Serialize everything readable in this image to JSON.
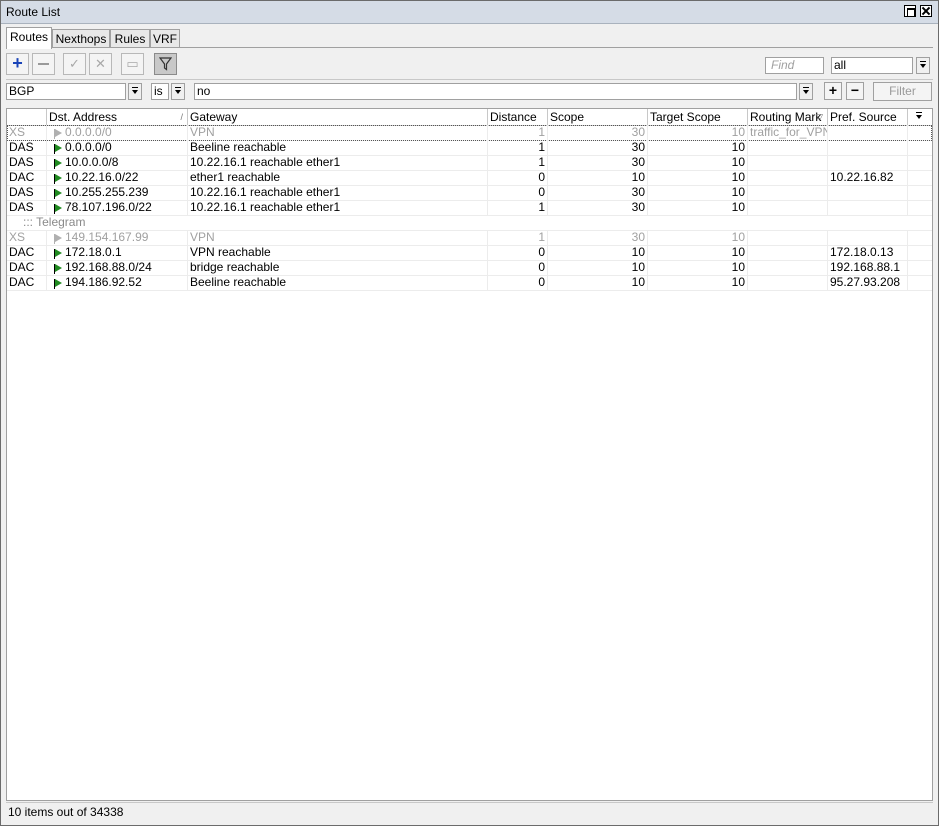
{
  "window": {
    "title": "Route List"
  },
  "tabs": [
    "Routes",
    "Nexthops",
    "Rules",
    "VRF"
  ],
  "toolbar": {
    "find_placeholder": "Find",
    "scope_select": "all"
  },
  "filter": {
    "field": "BGP",
    "operator": "is",
    "value": "no",
    "button_label": "Filter",
    "add_symbol": "+",
    "remove_symbol": "−"
  },
  "columns": [
    "",
    "Dst. Address",
    "Gateway",
    "Distance",
    "Scope",
    "Target Scope",
    "Routing Mark",
    "Pref. Source"
  ],
  "rows": [
    {
      "flags": "XS",
      "dst": "0.0.0.0/0",
      "gateway": "VPN",
      "distance": "1",
      "scope": "30",
      "target_scope": "10",
      "routing_mark": "traffic_for_VPN",
      "pref_source": ""
    },
    {
      "flags": "DAS",
      "dst": "0.0.0.0/0",
      "gateway": "Beeline reachable",
      "distance": "1",
      "scope": "30",
      "target_scope": "10",
      "routing_mark": "",
      "pref_source": ""
    },
    {
      "flags": "DAS",
      "dst": "10.0.0.0/8",
      "gateway": "10.22.16.1 reachable ether1",
      "distance": "1",
      "scope": "30",
      "target_scope": "10",
      "routing_mark": "",
      "pref_source": ""
    },
    {
      "flags": "DAC",
      "dst": "10.22.16.0/22",
      "gateway": "ether1 reachable",
      "distance": "0",
      "scope": "10",
      "target_scope": "10",
      "routing_mark": "",
      "pref_source": "10.22.16.82"
    },
    {
      "flags": "DAS",
      "dst": "10.255.255.239",
      "gateway": "10.22.16.1 reachable ether1",
      "distance": "0",
      "scope": "30",
      "target_scope": "10",
      "routing_mark": "",
      "pref_source": ""
    },
    {
      "flags": "DAS",
      "dst": "78.107.196.0/22",
      "gateway": "10.22.16.1 reachable ether1",
      "distance": "1",
      "scope": "30",
      "target_scope": "10",
      "routing_mark": "",
      "pref_source": ""
    },
    {
      "comment": "::: Telegram"
    },
    {
      "flags": "XS",
      "dst": "149.154.167.99",
      "gateway": "VPN",
      "distance": "1",
      "scope": "30",
      "target_scope": "10",
      "routing_mark": "",
      "pref_source": ""
    },
    {
      "flags": "DAC",
      "dst": "172.18.0.1",
      "gateway": "VPN reachable",
      "distance": "0",
      "scope": "10",
      "target_scope": "10",
      "routing_mark": "",
      "pref_source": "172.18.0.13"
    },
    {
      "flags": "DAC",
      "dst": "192.168.88.0/24",
      "gateway": "bridge reachable",
      "distance": "0",
      "scope": "10",
      "target_scope": "10",
      "routing_mark": "",
      "pref_source": "192.168.88.1"
    },
    {
      "flags": "DAC",
      "dst": "194.186.92.52",
      "gateway": "Beeline reachable",
      "distance": "0",
      "scope": "10",
      "target_scope": "10",
      "routing_mark": "",
      "pref_source": "95.27.93.208"
    }
  ],
  "status": {
    "text": "10 items out of 34338"
  },
  "colors": {
    "active_flag": "#1f8a1f",
    "disabled_text": "#a0a0a0",
    "add_icon": "#1a44b8",
    "titlebar": "#d5dce6"
  }
}
